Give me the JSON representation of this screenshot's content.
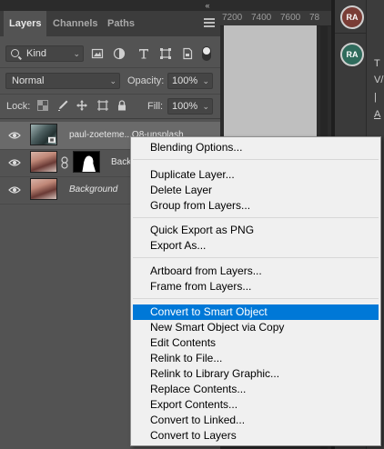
{
  "panel": {
    "tabs": [
      {
        "label": "Layers"
      },
      {
        "label": "Channels"
      },
      {
        "label": "Paths"
      }
    ],
    "collapse_glyph": "«",
    "filter": {
      "kind_label": "Kind"
    },
    "blend_mode": "Normal",
    "opacity_label": "Opacity:",
    "opacity_value": "100%",
    "lock_label": "Lock:",
    "fill_label": "Fill:",
    "fill_value": "100%"
  },
  "layers": [
    {
      "name": "paul-zoeteme...O8-unsplash",
      "visible": true,
      "selected": true
    },
    {
      "name": "Back",
      "visible": true,
      "selected": false
    },
    {
      "name": "Background",
      "visible": true,
      "selected": false
    }
  ],
  "ruler": [
    "7200",
    "7400",
    "7600",
    "78"
  ],
  "avatars": [
    "RA",
    "RA"
  ],
  "right_edge_glyphs": [
    "T",
    "V/",
    "|",
    "A"
  ],
  "context_menu": {
    "groups": [
      [
        "Blending Options..."
      ],
      [
        "Duplicate Layer...",
        "Delete Layer",
        "Group from Layers..."
      ],
      [
        "Quick Export as PNG",
        "Export As..."
      ],
      [
        "Artboard from Layers...",
        "Frame from Layers..."
      ],
      [
        "Convert to Smart Object",
        "New Smart Object via Copy",
        "Edit Contents",
        "Relink to File...",
        "Relink to Library Graphic...",
        "Replace Contents...",
        "Export Contents...",
        "Convert to Linked...",
        "Convert to Layers"
      ]
    ],
    "highlighted": "Convert to Smart Object"
  },
  "colors": {
    "menu_highlight": "#0078d7",
    "panel_bg": "#535353",
    "selected_row": "#6a6a6a",
    "avatar1": "#7a3d36",
    "avatar2": "#2f6b5c"
  }
}
